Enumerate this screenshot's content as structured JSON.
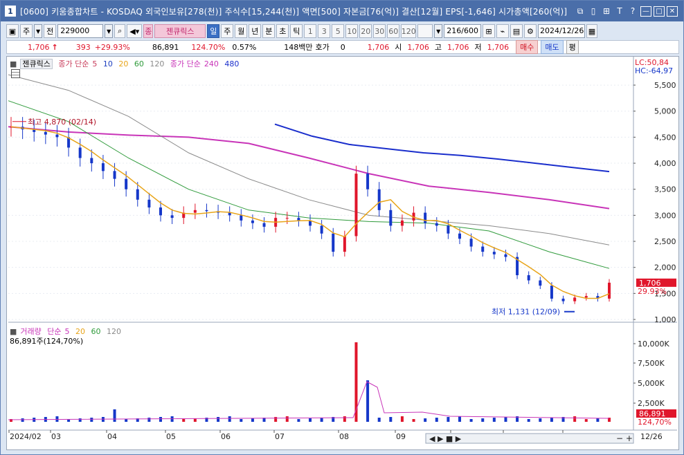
{
  "window": {
    "number": "1",
    "title": "[0600] 키움종합차트 - KOSDAQ 외국인보유[278(천)] 주식수[15,244(천)] 액면[500] 자본금[76(억)] 결산[12월] EPS[-1,646] 시가총액[260(억)]",
    "buttons": [
      "⧉",
      "▯",
      "⊞",
      "T",
      "?",
      "—",
      "□",
      "✕"
    ]
  },
  "toolbar": {
    "period_label": "주",
    "market_label": "전",
    "stock_code": "229000",
    "stock_name": "젠큐릭스",
    "stock_prefix": "종",
    "intervals": [
      "일",
      "주",
      "월",
      "년",
      "분",
      "초",
      "틱"
    ],
    "active_interval": "일",
    "numbers": [
      "1",
      "3",
      "5",
      "10",
      "20",
      "30",
      "60",
      "120"
    ],
    "count": "216",
    "count_total": "/600",
    "date": "2024/12/26"
  },
  "pricebar": {
    "price": "1,706",
    "arrow": "↑",
    "change": "393",
    "change_pct": "+29.93%",
    "volume": "86,891",
    "volume_ratio": "124.70%",
    "turnover": "0.57%",
    "amount": "148백만",
    "quote_label": "호가",
    "quote_value": "0",
    "current": "1,706",
    "open_label": "시",
    "open": "1,706",
    "high_label": "고",
    "high": "1,706",
    "low_label": "저",
    "low": "1,706",
    "sell_label": "매수",
    "buy_label": "매도",
    "flat_label": "평"
  },
  "price_legend": {
    "name": "젠큐릭스",
    "sma_label": "종가 단순",
    "periods": [
      "5",
      "10",
      "20",
      "60",
      "120"
    ],
    "long_label": "종가 단순",
    "long_periods": [
      "240",
      "480"
    ]
  },
  "volume_legend": {
    "name": "거래량",
    "sma_label": "단순",
    "periods": [
      "5",
      "20",
      "60",
      "120"
    ],
    "current": "86,891주(124,70%)"
  },
  "annotations": {
    "lc": "LC:50,84",
    "hc": "HC:-64,97",
    "high_mark": "최고 4,870 (02/14)",
    "low_mark": "최저 1,131 (12/09)",
    "price_tag": "1,706",
    "price_pct": "29.93%",
    "vol_tag": "86,891",
    "vol_pct": "124,70%"
  },
  "colors": {
    "up": "#e0162b",
    "down": "#1537c9",
    "ma5": "#1e3fbf",
    "ma10": "#1e3fbf",
    "ma20": "#e8a418",
    "ma60": "#2e9a3a",
    "ma120": "#8a8a8a",
    "ma240": "#c834b8",
    "ma480": "#1a2ecc"
  },
  "chart_data": {
    "type": "line",
    "price_axis": [
      "5,500",
      "5,000",
      "4,500",
      "4,000",
      "3,500",
      "3,000",
      "2,500",
      "2,000",
      "1,500",
      "1,000"
    ],
    "volume_axis": [
      "10,000K",
      "7,500K",
      "5,000K",
      "2,500K"
    ],
    "x_labels": [
      "2024/02",
      "03",
      "04",
      "05",
      "06",
      "07",
      "08",
      "09",
      "10",
      "11",
      "12"
    ],
    "last_date_label": "12/26",
    "ylim": [
      1000,
      5700
    ],
    "series": [
      {
        "name": "종가 단순 240",
        "values": [
          4700,
          4600,
          4540,
          4500,
          4380,
          4100,
          3800,
          3560,
          3440,
          3300,
          3130
        ]
      },
      {
        "name": "종가 단순 480",
        "values": [
          4750,
          4520,
          4360,
          4280,
          4200,
          4150,
          4080,
          4000,
          3920,
          3840
        ]
      },
      {
        "name": "종가 단순 120",
        "values": [
          5700,
          5400,
          4900,
          4200,
          3700,
          3300,
          3000,
          2900,
          2800,
          2650,
          2430
        ]
      },
      {
        "name": "종가 단순 60",
        "values": [
          5200,
          4800,
          4100,
          3500,
          3100,
          2950,
          2880,
          2850,
          2700,
          2300,
          1980
        ]
      }
    ],
    "closes": [
      4700,
      4650,
      4600,
      4550,
      4500,
      4300,
      4100,
      4000,
      3850,
      3700,
      3500,
      3300,
      3150,
      3000,
      2950,
      3050,
      3100,
      3080,
      3050,
      3000,
      2900,
      2850,
      2780,
      2950,
      2950,
      2900,
      2800,
      2650,
      2300,
      2600,
      3800,
      3500,
      3100,
      2800,
      2900,
      3050,
      2850,
      2800,
      2650,
      2550,
      2400,
      2300,
      2250,
      2200,
      1850,
      1750,
      1650,
      1400,
      1350,
      1420,
      1450,
      1400,
      1706
    ]
  }
}
